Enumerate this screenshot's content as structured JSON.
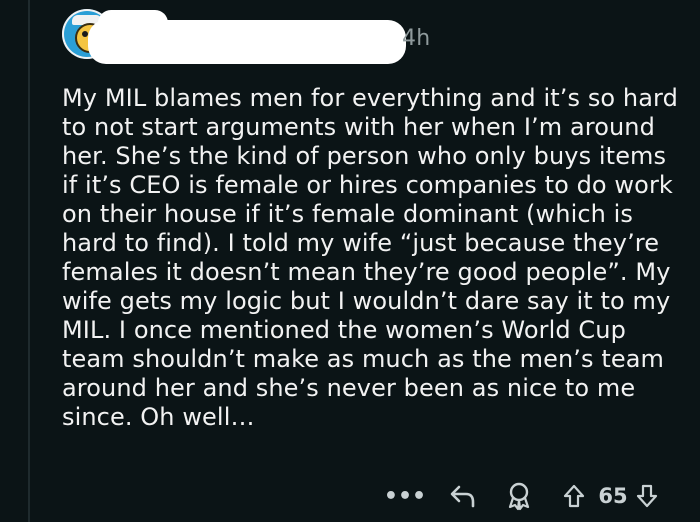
{
  "comment": {
    "time": "4h",
    "text": "My MIL blames men for everything and it’s so hard\nto not start arguments with her when I’m around\nher.  She’s the kind of person who only buys items\nif it’s CEO is female or hires companies to do work\non their house if it’s female dominant (which is\nhard to find).  I told my wife “just because they’re\nfemales it doesn’t mean they’re good people”.  My\nwife gets my logic but I wouldn’t dare say it to my\nMIL.  I once mentioned the women’s World Cup\nteam shouldn’t make as much as the men’s team\naround her and she’s never been as nice to me\nsince.  Oh well…"
  },
  "actions": {
    "more": "•••",
    "vote_count": "65"
  },
  "colors": {
    "background": "#0b1416",
    "text": "#f2f2f2",
    "muted": "#8f9a9c",
    "icons": "#c9d1d3"
  },
  "icons": {
    "reply": "reply-arrow-icon",
    "award": "award-icon",
    "upvote": "upvote-arrow-icon",
    "downvote": "downvote-arrow-icon"
  }
}
